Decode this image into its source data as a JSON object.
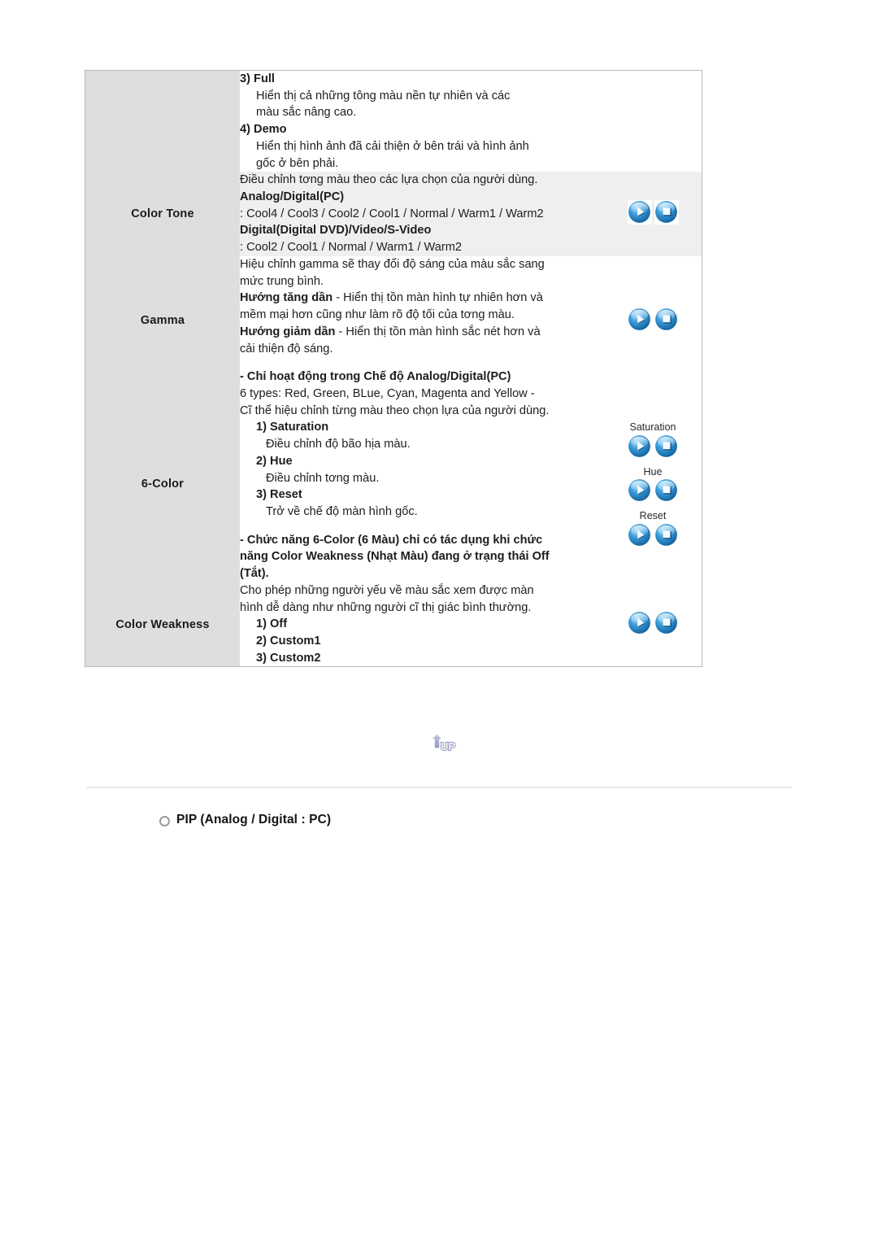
{
  "document": {
    "section_heading": "PIP (Analog / Digital : PC)",
    "up_button_label": "UP"
  },
  "spec_table": {
    "rows": [
      {
        "label": "",
        "shaded": false,
        "lines": [
          {
            "text": "3) Full",
            "bold": true,
            "indent": 0
          },
          {
            "text": "Hiển thị cả những tông màu nền tự nhiên và các",
            "bold": false,
            "indent": 1
          },
          {
            "text": "màu sắc nâng cao.",
            "bold": false,
            "indent": 1
          },
          {
            "text": "4) Demo",
            "bold": true,
            "indent": 0
          },
          {
            "text": "Hiển thị hình ảnh đã cải thiện ở bên trái và hình ảnh",
            "bold": false,
            "indent": 1
          },
          {
            "text": "gốc ở bên phải.",
            "bold": false,
            "indent": 1
          }
        ],
        "buttons": []
      },
      {
        "label": "Color Tone",
        "shaded": true,
        "lines": [
          {
            "text": "Điều chỉnh tơng màu theo các lựa chọn của người dùng.",
            "bold": false,
            "indent": 0
          },
          {
            "text": "Analog/Digital(PC)",
            "bold": true,
            "indent": 0
          },
          {
            "text": ": Cool4 / Cool3 / Cool2 / Cool1 / Normal / Warm1 / Warm2",
            "bold": false,
            "indent": 0
          },
          {
            "text": "Digital(Digital DVD)/Video/S-Video",
            "bold": true,
            "indent": 0
          },
          {
            "text": ": Cool2 / Cool1 / Normal / Warm1 / Warm2",
            "bold": false,
            "indent": 0
          }
        ],
        "buttons": [
          {
            "label": "",
            "icons": [
              "play-icon",
              "stop-icon"
            ],
            "boxed": true
          }
        ]
      },
      {
        "label": "Gamma",
        "shaded": false,
        "lines": [
          {
            "text": "Hiệu chỉnh gamma sẽ thay đổi độ sáng của màu sắc sang",
            "bold": false,
            "indent": 0
          },
          {
            "text": "mức trung bình.",
            "bold": false,
            "indent": 0
          },
          {
            "text": "Hướng tăng dần - Hiển thị tồn màn hình tự nhiên hơn và",
            "bold": false,
            "indent": 0,
            "bold_prefix": "Hướng tăng dần"
          },
          {
            "text": "mềm mại hơn cũng như làm rõ độ tối của tơng màu.",
            "bold": false,
            "indent": 0
          },
          {
            "text": "Hướng giảm dần - Hiển thị tồn màn hình sắc nét hơn và",
            "bold": false,
            "indent": 0,
            "bold_prefix": "Hướng giảm dần"
          },
          {
            "text": "cải thiện độ sáng.",
            "bold": false,
            "indent": 0
          },
          {
            "text": "",
            "bold": false,
            "indent": 0,
            "spacer": true
          },
          {
            "text": "- Chỉ hoạt động trong Chế độ Analog/Digital(PC)",
            "bold": true,
            "indent": 0
          }
        ],
        "buttons": [
          {
            "label": "",
            "icons": [
              "play-icon",
              "stop-icon"
            ],
            "boxed": false
          }
        ]
      },
      {
        "label": "6-Color",
        "shaded": false,
        "lines": [
          {
            "text": "6 types: Red, Green, BLue, Cyan, Magenta and Yellow -",
            "bold": false,
            "indent": 0
          },
          {
            "text": "Cĩ thể hiệu chỉnh từng màu theo chọn lựa của người dùng.",
            "bold": false,
            "indent": 0
          },
          {
            "text": "1) Saturation",
            "bold": true,
            "indent": 1
          },
          {
            "text": "Điều chỉnh độ bão hịa màu.",
            "bold": false,
            "indent": 2
          },
          {
            "text": "2) Hue",
            "bold": true,
            "indent": 1
          },
          {
            "text": "Điều chỉnh tơng màu.",
            "bold": false,
            "indent": 2
          },
          {
            "text": "3) Reset",
            "bold": true,
            "indent": 1
          },
          {
            "text": "Trở về chế độ màn hình gốc.",
            "bold": false,
            "indent": 2
          },
          {
            "text": "",
            "bold": false,
            "indent": 0,
            "spacer": true
          },
          {
            "text": "- Chức năng 6-Color (6 Màu) chỉ có tác dụng khi chức",
            "bold": true,
            "indent": 0
          },
          {
            "text": "năng Color Weakness (Nhạt Màu) đang ở trạng thái Off",
            "bold": true,
            "indent": 0
          },
          {
            "text": "(Tắt).",
            "bold": true,
            "indent": 0
          }
        ],
        "buttons": [
          {
            "label": "Saturation",
            "icons": [
              "play-icon",
              "stop-icon"
            ],
            "boxed": true
          },
          {
            "label": "Hue",
            "icons": [
              "play-icon",
              "stop-icon"
            ],
            "boxed": true
          },
          {
            "label": "Reset",
            "icons": [
              "play-icon",
              "stop-icon"
            ],
            "boxed": true
          }
        ]
      },
      {
        "label": "Color Weakness",
        "shaded": false,
        "lines": [
          {
            "text": "Cho phép những người yếu về màu sắc xem được màn",
            "bold": false,
            "indent": 0
          },
          {
            "text": "hình dễ dàng như những người cĩ thị giác bình thường.",
            "bold": false,
            "indent": 0
          },
          {
            "text": "1) Off",
            "bold": true,
            "indent": 1
          },
          {
            "text": "2) Custom1",
            "bold": true,
            "indent": 1
          },
          {
            "text": "3) Custom2",
            "bold": true,
            "indent": 1
          }
        ],
        "buttons": [
          {
            "label": "",
            "icons": [
              "play-icon",
              "stop-icon"
            ],
            "boxed": false
          }
        ]
      }
    ]
  },
  "colors": {
    "label_cell_bg": "#dedede",
    "shaded_cell_bg": "#efefef",
    "table_border": "#b9b9b9",
    "button_blue": "#2f8fd4",
    "up_arrow": "#9a9ec6",
    "divider": "#eceae4"
  }
}
